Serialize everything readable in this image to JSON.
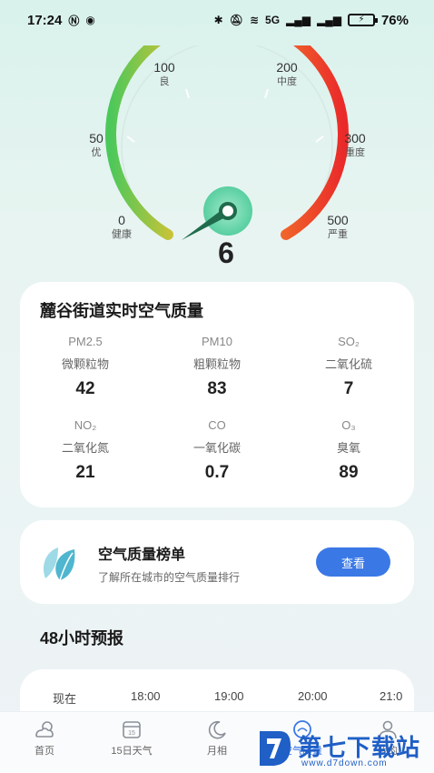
{
  "status_bar": {
    "time": "17:24",
    "left_icons": [
      "nfc-icon",
      "app-notification-icon"
    ],
    "network": "5G",
    "battery": "76%"
  },
  "gauge": {
    "aqi": "6",
    "level_fraction": 0.012,
    "scale": [
      {
        "num": "0",
        "word": "健康"
      },
      {
        "num": "50",
        "word": "优"
      },
      {
        "num": "100",
        "word": "良"
      },
      {
        "num": "200",
        "word": "中度"
      },
      {
        "num": "300",
        "word": "重度"
      },
      {
        "num": "500",
        "word": "严重"
      }
    ],
    "colors": {
      "green": "#4cc85a",
      "yellow": "#f3c12b",
      "orange": "#f27a2a",
      "red": "#ea2a2a",
      "teal": "#2a8f6e"
    }
  },
  "air_quality": {
    "title": "麓谷街道实时空气质量",
    "pollutants": [
      {
        "code": "PM2.5",
        "name": "微颗粒物",
        "value": "42"
      },
      {
        "code": "PM10",
        "name": "粗颗粒物",
        "value": "83"
      },
      {
        "code": "SO₂",
        "name": "二氧化硫",
        "value": "7"
      },
      {
        "code": "NO₂",
        "name": "二氧化氮",
        "value": "21"
      },
      {
        "code": "CO",
        "name": "一氧化碳",
        "value": "0.7"
      },
      {
        "code": "O₃",
        "name": "臭氧",
        "value": "89"
      }
    ]
  },
  "ranking": {
    "title": "空气质量榜单",
    "subtitle": "了解所在城市的空气质量排行",
    "button": "查看",
    "accent": "#3a78e6"
  },
  "forecast": {
    "title": "48小时预报",
    "hours": [
      "现在",
      "18:00",
      "19:00",
      "20:00",
      "21:0"
    ]
  },
  "nav": {
    "items": [
      {
        "label": "首页",
        "icon": "weather-home-icon"
      },
      {
        "label": "15日天气",
        "icon": "calendar-15-icon"
      },
      {
        "label": "月相",
        "icon": "moon-icon"
      },
      {
        "label": "空气质量",
        "icon": "air-quality-icon"
      },
      {
        "label": "我的",
        "icon": "profile-icon"
      }
    ]
  },
  "watermark": {
    "name": "第七下载站",
    "url": "www.d7down.com"
  }
}
